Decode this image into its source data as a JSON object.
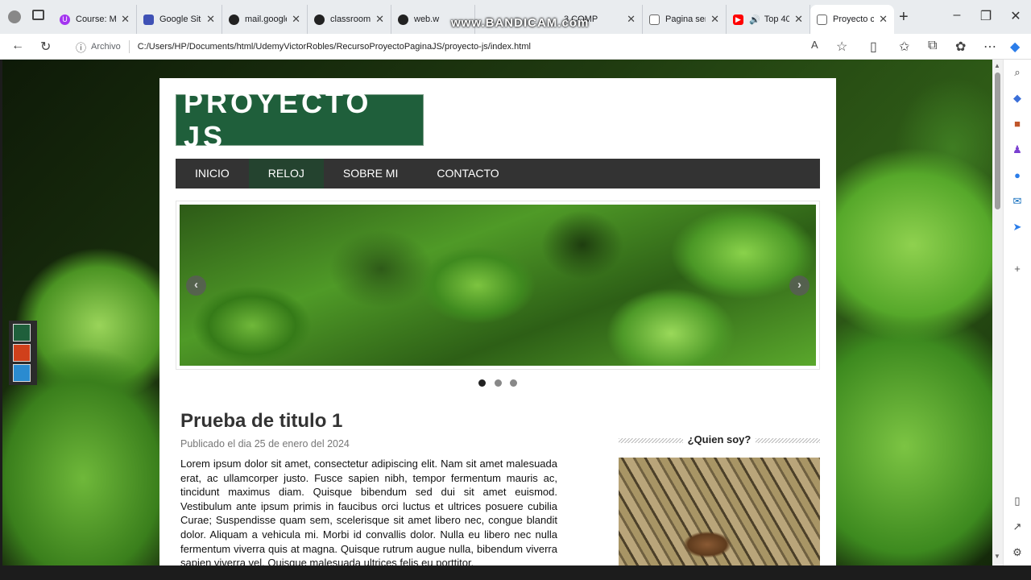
{
  "browser": {
    "tabs": [
      {
        "title": "Course: Mas",
        "icon": "udemy-icon",
        "color": "#a435f0"
      },
      {
        "title": "Google Sites",
        "icon": "google-sites-icon",
        "color": "#3f51b5"
      },
      {
        "title": "mail.google.",
        "icon": "github-icon",
        "color": "#222222"
      },
      {
        "title": "classroom.g",
        "icon": "github-icon",
        "color": "#222222"
      },
      {
        "title": "web.w",
        "icon": "github-icon",
        "color": "#222222"
      },
      {
        "title": "3 COMP",
        "icon": "doc-icon",
        "color": "#555555"
      },
      {
        "title": "Pagina senc",
        "icon": "doc-icon",
        "color": "#555555"
      },
      {
        "title": "Top 40",
        "icon": "youtube-icon",
        "color": "#ff0000"
      },
      {
        "title": "Proyecto co",
        "icon": "doc-icon",
        "color": "#555555"
      }
    ],
    "watermark": "www.BANDICAM.com",
    "address": {
      "prefix": "Archivo",
      "url": "C:/Users/HP/Documents/html/UdemyVictorRobles/RecursoProyectoPaginaJS/proyecto-js/index.html"
    }
  },
  "site": {
    "logo": "PROYECTO JS",
    "menu": [
      {
        "label": "INICIO",
        "active": false
      },
      {
        "label": "RELOJ",
        "active": true
      },
      {
        "label": "SOBRE MI",
        "active": false
      },
      {
        "label": "CONTACTO",
        "active": false
      }
    ],
    "themes": [
      {
        "name": "green-theme",
        "color": "#1f5f3b"
      },
      {
        "name": "red-theme",
        "color": "#d0401b"
      },
      {
        "name": "blue-theme",
        "color": "#2a8bd0"
      }
    ],
    "slider": {
      "arrows": {
        "prev": "‹",
        "next": "›"
      },
      "dots": 3,
      "active_dot": 0
    },
    "article": {
      "title": "Prueba de titulo 1",
      "date": "Publicado el dia 25 de enero del 2024",
      "body": "Lorem ipsum dolor sit amet, consectetur adipiscing elit. Nam sit amet malesuada erat, ac ullamcorper justo. Fusce sapien nibh, tempor fermentum mauris ac, tincidunt maximus diam. Quisque bibendum sed dui sit amet euismod. Vestibulum ante ipsum primis in faucibus orci luctus et ultrices posuere cubilia Curae; Suspendisse quam sem, scelerisque sit amet libero nec, congue blandit dolor. Aliquam a vehicula mi. Morbi id convallis dolor. Nulla eu libero nec nulla fermentum viverra quis at magna. Quisque rutrum augue nulla, bibendum viverra sapien viverra vel. Quisque malesuada ultrices felis eu porttitor."
    },
    "aside": {
      "title": "¿Quien soy?"
    }
  }
}
